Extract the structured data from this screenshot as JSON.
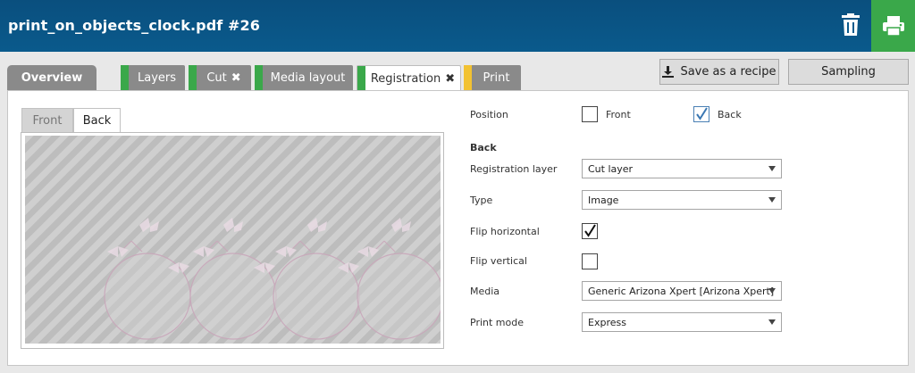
{
  "header": {
    "title": "print_on_objects_clock.pdf #26"
  },
  "tabs": {
    "overview": "Overview",
    "layers": "Layers",
    "cut": "Cut",
    "media_layout": "Media layout",
    "registration": "Registration",
    "print": "Print",
    "close_glyph": "✖"
  },
  "actions": {
    "save_recipe": "Save as a recipe",
    "sampling": "Sampling"
  },
  "preview": {
    "front_tab": "Front",
    "back_tab": "Back"
  },
  "form": {
    "position_label": "Position",
    "front_option": "Front",
    "front_checked": false,
    "back_option": "Back",
    "back_checked": true,
    "section_heading": "Back",
    "registration_layer": {
      "label": "Registration layer",
      "value": "Cut layer"
    },
    "type": {
      "label": "Type",
      "value": "Image"
    },
    "flip_horizontal": {
      "label": "Flip horizontal",
      "checked": true
    },
    "flip_vertical": {
      "label": "Flip vertical",
      "checked": false
    },
    "media": {
      "label": "Media",
      "value": "Generic Arizona Xpert [Arizona Xpert]"
    },
    "print_mode": {
      "label": "Print mode",
      "value": "Express"
    }
  },
  "colors": {
    "header": "#0a5a8c",
    "green": "#3aa84a",
    "yellow": "#f2c232",
    "tab_gray": "#8a8a8a"
  }
}
